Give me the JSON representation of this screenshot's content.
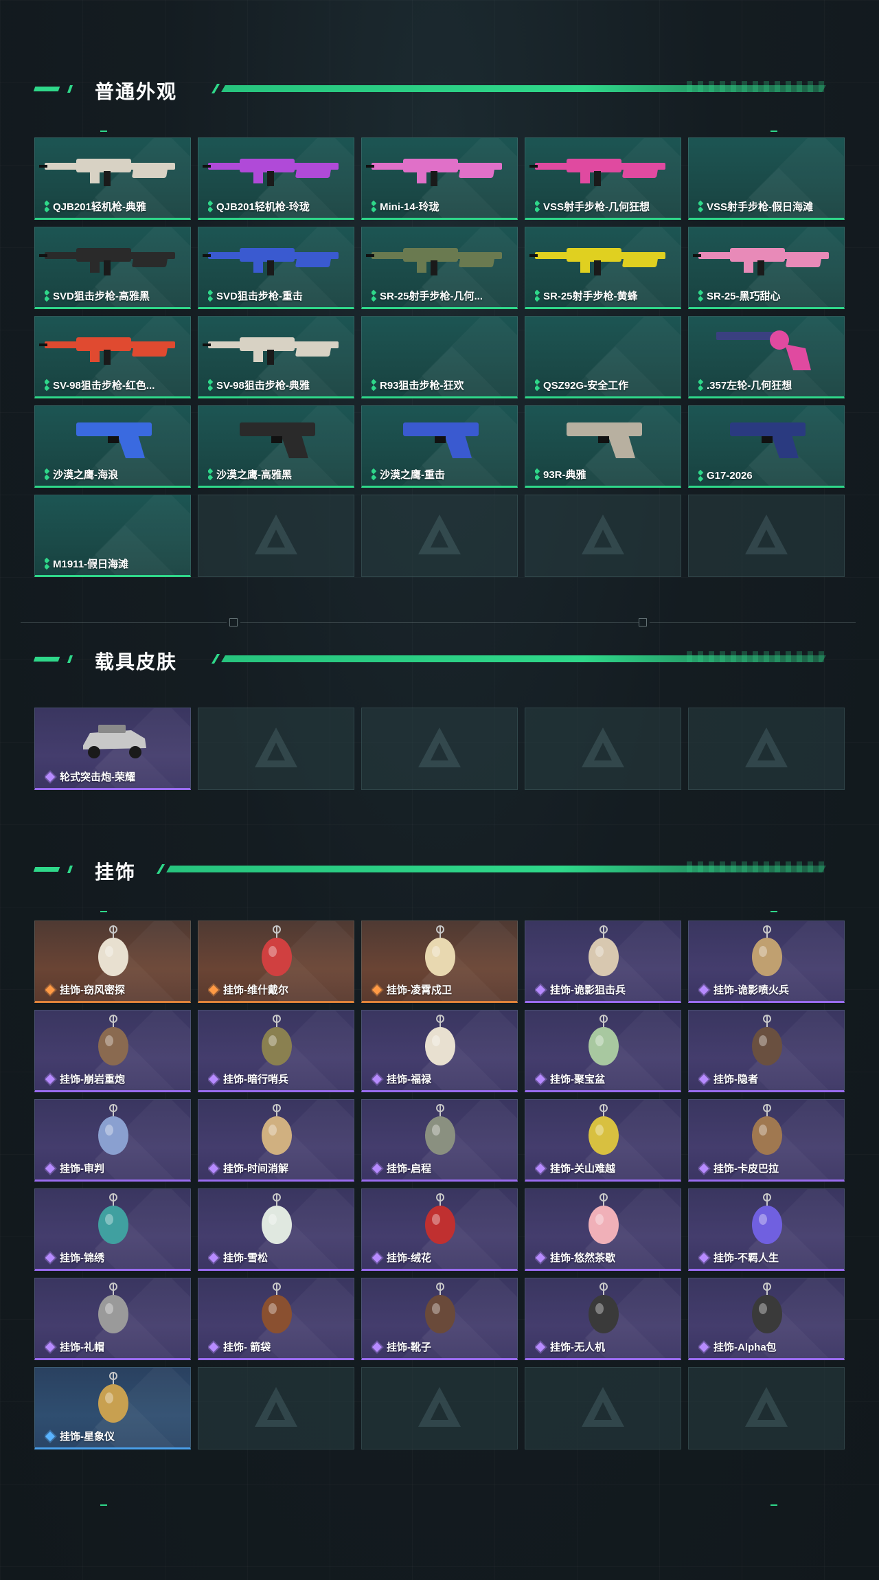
{
  "sections": {
    "weapons": {
      "title": "普通外观",
      "items": [
        {
          "name": "QJB201轻机枪-典雅",
          "rarity": "green",
          "art": "rifle-icon",
          "color": "#d8d2c4"
        },
        {
          "name": "QJB201轻机枪-玲珑",
          "rarity": "green",
          "art": "rifle-icon",
          "color": "#b04ad8"
        },
        {
          "name": "Mini-14-玲珑",
          "rarity": "green",
          "art": "rifle-icon",
          "color": "#e070c8"
        },
        {
          "name": "VSS射手步枪-几何狂想",
          "rarity": "green",
          "art": "rifle-icon",
          "color": "#e04aa0"
        },
        {
          "name": "VSS射手步枪-假日海滩",
          "rarity": "green",
          "art": "",
          "color": ""
        },
        {
          "name": "SVD狙击步枪-高雅黑",
          "rarity": "green",
          "art": "rifle-icon",
          "color": "#2a2a2a"
        },
        {
          "name": "SVD狙击步枪-重击",
          "rarity": "green",
          "art": "rifle-icon",
          "color": "#3a5ad0"
        },
        {
          "name": "SR-25射手步枪-几何...",
          "rarity": "green",
          "art": "rifle-icon",
          "color": "#6a7a50"
        },
        {
          "name": "SR-25射手步枪-黄蜂",
          "rarity": "green",
          "art": "rifle-icon",
          "color": "#e0d020"
        },
        {
          "name": "SR-25-黑巧甜心",
          "rarity": "green",
          "art": "rifle-icon",
          "color": "#e88ab8"
        },
        {
          "name": "SV-98狙击步枪-红色...",
          "rarity": "green",
          "art": "rifle-icon",
          "color": "#e04a30"
        },
        {
          "name": "SV-98狙击步枪-典雅",
          "rarity": "green",
          "art": "rifle-icon",
          "color": "#d8d2c4"
        },
        {
          "name": "R93狙击步枪-狂欢",
          "rarity": "green",
          "art": "",
          "color": ""
        },
        {
          "name": "QSZ92G-安全工作",
          "rarity": "green",
          "art": "",
          "color": ""
        },
        {
          "name": ".357左轮-几何狂想",
          "rarity": "green",
          "art": "revolver-icon",
          "color": "#e04aa0"
        },
        {
          "name": "沙漠之鹰-海浪",
          "rarity": "green",
          "art": "pistol-icon",
          "color": "#3a6ae0"
        },
        {
          "name": "沙漠之鹰-高雅黑",
          "rarity": "green",
          "art": "pistol-icon",
          "color": "#2a2a2a"
        },
        {
          "name": "沙漠之鹰-重击",
          "rarity": "green",
          "art": "pistol-icon",
          "color": "#3a5ad0"
        },
        {
          "name": "93R-典雅",
          "rarity": "green",
          "art": "pistol-icon",
          "color": "#b8b0a0"
        },
        {
          "name": "G17-2026",
          "rarity": "green",
          "art": "pistol-icon",
          "color": "#2a3a80"
        },
        {
          "name": "M1911-假日海滩",
          "rarity": "green",
          "art": "",
          "color": ""
        }
      ],
      "empty_slots": 4
    },
    "vehicles": {
      "title": "载具皮肤",
      "items": [
        {
          "name": "轮式突击炮-荣耀",
          "rarity": "purple",
          "art": "vehicle-icon",
          "color": "#c8c8c8"
        }
      ],
      "empty_slots": 4
    },
    "charms": {
      "title": "挂饰",
      "items": [
        {
          "name": "挂饰-窃风密探",
          "rarity": "orange",
          "art": "charm-icon",
          "color": "#e8e0d0"
        },
        {
          "name": "挂饰-维什戴尔",
          "rarity": "orange",
          "art": "charm-icon",
          "color": "#d04040"
        },
        {
          "name": "挂饰-凌霄戍卫",
          "rarity": "orange",
          "art": "charm-icon",
          "color": "#e8d8b0"
        },
        {
          "name": "挂饰-诡影狙击兵",
          "rarity": "purple",
          "art": "charm-icon",
          "color": "#d8c8b0"
        },
        {
          "name": "挂饰-诡影喷火兵",
          "rarity": "purple",
          "art": "charm-icon",
          "color": "#c0a070"
        },
        {
          "name": "挂饰-崩岩重炮",
          "rarity": "purple",
          "art": "charm-icon",
          "color": "#8a6a50"
        },
        {
          "name": "挂饰-暗行哨兵",
          "rarity": "purple",
          "art": "charm-icon",
          "color": "#8a8050"
        },
        {
          "name": "挂饰-福禄",
          "rarity": "purple",
          "art": "charm-icon",
          "color": "#e8e0d0"
        },
        {
          "name": "挂饰-聚宝盆",
          "rarity": "purple",
          "art": "charm-icon",
          "color": "#a8c8a0"
        },
        {
          "name": "挂饰-隐者",
          "rarity": "purple",
          "art": "charm-icon",
          "color": "#6a5040"
        },
        {
          "name": "挂饰-审判",
          "rarity": "purple",
          "art": "charm-icon",
          "color": "#8aa0d0"
        },
        {
          "name": "挂饰-时间消解",
          "rarity": "purple",
          "art": "charm-icon",
          "color": "#d0b080"
        },
        {
          "name": "挂饰-启程",
          "rarity": "purple",
          "art": "charm-icon",
          "color": "#8a9080"
        },
        {
          "name": "挂饰-关山难越",
          "rarity": "purple",
          "art": "charm-icon",
          "color": "#d8c040"
        },
        {
          "name": "挂饰-卡皮巴拉",
          "rarity": "purple",
          "art": "charm-icon",
          "color": "#a07850"
        },
        {
          "name": "挂饰-锦绣",
          "rarity": "purple",
          "art": "charm-icon",
          "color": "#40a0a0"
        },
        {
          "name": "挂饰-雪松",
          "rarity": "purple",
          "art": "charm-icon",
          "color": "#e0e8e0"
        },
        {
          "name": "挂饰-绒花",
          "rarity": "purple",
          "art": "charm-icon",
          "color": "#c03030"
        },
        {
          "name": "挂饰-悠然茶歇",
          "rarity": "purple",
          "art": "charm-icon",
          "color": "#f0b0b8"
        },
        {
          "name": "挂饰-不羁人生",
          "rarity": "purple",
          "art": "charm-icon",
          "color": "#7060e0"
        },
        {
          "name": "挂饰-礼帽",
          "rarity": "purple",
          "art": "charm-icon",
          "color": "#9a9a9a"
        },
        {
          "name": "挂饰- 箭袋",
          "rarity": "purple",
          "art": "charm-icon",
          "color": "#8a5030"
        },
        {
          "name": "挂饰-靴子",
          "rarity": "purple",
          "art": "charm-icon",
          "color": "#6a4a3a"
        },
        {
          "name": "挂饰-无人机",
          "rarity": "purple",
          "art": "charm-icon",
          "color": "#3a3a3a"
        },
        {
          "name": "挂饰-Alpha包",
          "rarity": "purple",
          "art": "charm-icon",
          "color": "#3a3a3a"
        },
        {
          "name": "挂饰-星象仪",
          "rarity": "blue",
          "art": "charm-icon",
          "color": "#c8a050"
        }
      ],
      "empty_slots": 4
    }
  },
  "colors": {
    "accent": "#2fd88a",
    "purple": "#9a6cf0",
    "orange": "#e0833a",
    "blue": "#4aa0ea"
  }
}
